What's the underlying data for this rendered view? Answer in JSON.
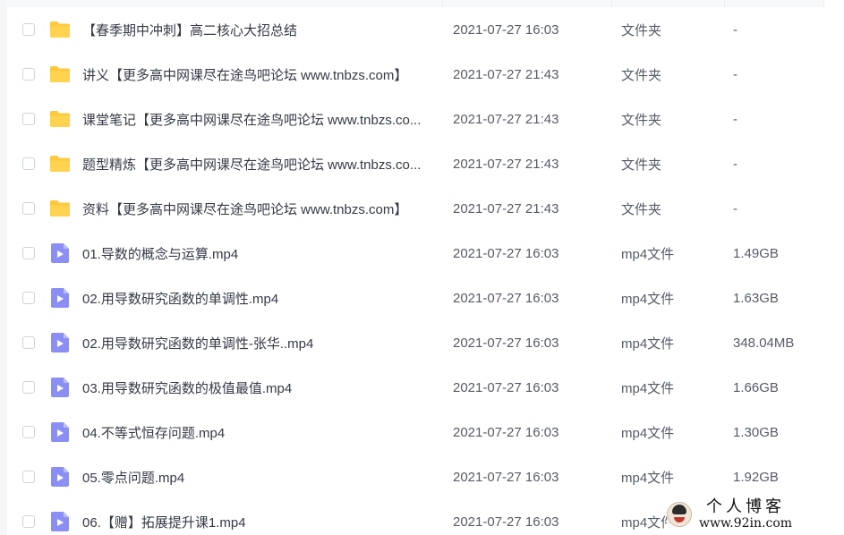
{
  "files": [
    {
      "name": "【春季期中冲刺】高二核心大招总结",
      "date": "2021-07-27 16:03",
      "type": "文件夹",
      "size": "-",
      "icon": "folder-icon"
    },
    {
      "name": "讲义【更多高中网课尽在途鸟吧论坛 www.tnbzs.com】",
      "date": "2021-07-27 21:43",
      "type": "文件夹",
      "size": "-",
      "icon": "folder-icon"
    },
    {
      "name": "课堂笔记【更多高中网课尽在途鸟吧论坛 www.tnbzs.co...",
      "date": "2021-07-27 21:43",
      "type": "文件夹",
      "size": "-",
      "icon": "folder-icon"
    },
    {
      "name": "题型精炼【更多高中网课尽在途鸟吧论坛 www.tnbzs.co...",
      "date": "2021-07-27 21:43",
      "type": "文件夹",
      "size": "-",
      "icon": "folder-icon"
    },
    {
      "name": "资料【更多高中网课尽在途鸟吧论坛 www.tnbzs.com】",
      "date": "2021-07-27 21:43",
      "type": "文件夹",
      "size": "-",
      "icon": "folder-icon"
    },
    {
      "name": "01.导数的概念与运算.mp4",
      "date": "2021-07-27 16:03",
      "type": "mp4文件",
      "size": "1.49GB",
      "icon": "video-file-icon"
    },
    {
      "name": "02.用导数研究函数的单调性.mp4",
      "date": "2021-07-27 16:03",
      "type": "mp4文件",
      "size": "1.63GB",
      "icon": "video-file-icon"
    },
    {
      "name": "02.用导数研究函数的单调性-张华..mp4",
      "date": "2021-07-27 16:03",
      "type": "mp4文件",
      "size": "348.04MB",
      "icon": "video-file-icon"
    },
    {
      "name": "03.用导数研究函数的极值最值.mp4",
      "date": "2021-07-27 16:03",
      "type": "mp4文件",
      "size": "1.66GB",
      "icon": "video-file-icon"
    },
    {
      "name": "04.不等式恒存问题.mp4",
      "date": "2021-07-27 16:03",
      "type": "mp4文件",
      "size": "1.30GB",
      "icon": "video-file-icon"
    },
    {
      "name": "05.零点问题.mp4",
      "date": "2021-07-27 16:03",
      "type": "mp4文件",
      "size": "1.92GB",
      "icon": "video-file-icon"
    },
    {
      "name": "06.【赠】拓展提升课1.mp4",
      "date": "2021-07-27 16:03",
      "type": "mp4文件",
      "size": "",
      "icon": "video-file-icon"
    }
  ],
  "watermark": {
    "title": "个人博客",
    "url": "www.92in.com"
  },
  "colors": {
    "folder": "#ffc93d",
    "video": "#8b8ff5",
    "text": "#333a45",
    "meta": "#555c66"
  }
}
